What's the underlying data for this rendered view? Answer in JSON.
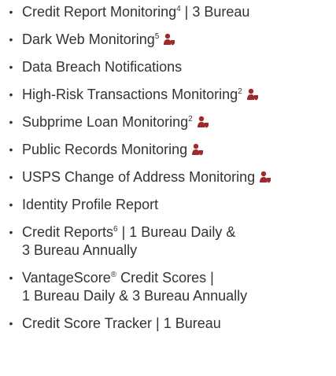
{
  "colors": {
    "text": "#333333",
    "icon_accent": "#9e2a2b"
  },
  "icons": {
    "identity": "person-alert-icon"
  },
  "features": [
    {
      "text": "Credit Report Monitoring",
      "sup": "4",
      "suffix": " | 3 Bureau",
      "icon": false
    },
    {
      "text": "Dark Web Monitoring",
      "sup": "5",
      "suffix": "",
      "icon": true
    },
    {
      "text": "Data Breach Notifications",
      "sup": "",
      "suffix": "",
      "icon": false
    },
    {
      "text": "High-Risk Transactions Monitoring",
      "sup": "2",
      "suffix": "",
      "icon": true
    },
    {
      "text": "Subprime Loan Monitoring",
      "sup": "2",
      "suffix": "",
      "icon": true
    },
    {
      "text": "Public Records Monitoring",
      "sup": "",
      "suffix": "",
      "icon": true
    },
    {
      "text": "USPS Change of Address Monitoring",
      "sup": "",
      "suffix": "",
      "icon": true
    },
    {
      "text": "Identity Profile Report",
      "sup": "",
      "suffix": "",
      "icon": false
    },
    {
      "line1_text": "Credit Reports",
      "line1_sup": "6",
      "line1_suffix": " | 1 Bureau Daily &",
      "line2": "3 Bureau Annually"
    },
    {
      "line1_text": "VantageScore",
      "line1_sup": "®",
      "line1_suffix": " Credit Scores |",
      "line2": "1 Bureau Daily & 3 Bureau Annually"
    },
    {
      "text": "Credit Score Tracker | 1 Bureau",
      "sup": "",
      "suffix": "",
      "icon": false
    }
  ]
}
